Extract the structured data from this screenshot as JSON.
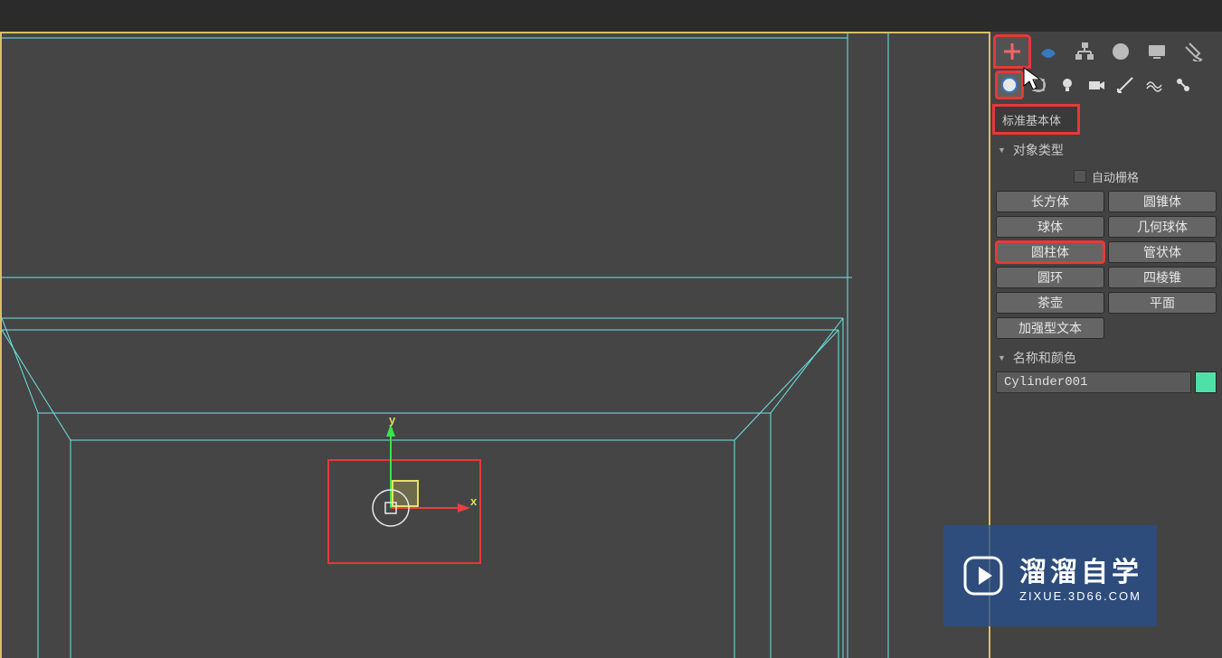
{
  "panel": {
    "dropdown_label": "标准基本体",
    "rollout_object_type": "对象类型",
    "autogrid_label": "自动栅格",
    "buttons": {
      "box": "长方体",
      "cone": "圆锥体",
      "sphere": "球体",
      "geosphere": "几何球体",
      "cylinder": "圆柱体",
      "tube": "管状体",
      "torus": "圆环",
      "pyramid": "四棱锥",
      "teapot": "茶壶",
      "plane": "平面",
      "textplus": "加强型文本"
    },
    "rollout_name_color": "名称和颜色",
    "object_name": "Cylinder001",
    "object_color": "#4fe0a8"
  },
  "viewport": {
    "axis_x": "x",
    "axis_y": "y"
  },
  "watermark": {
    "title": "溜溜自学",
    "subtitle": "ZIXUE.3D66.COM"
  }
}
